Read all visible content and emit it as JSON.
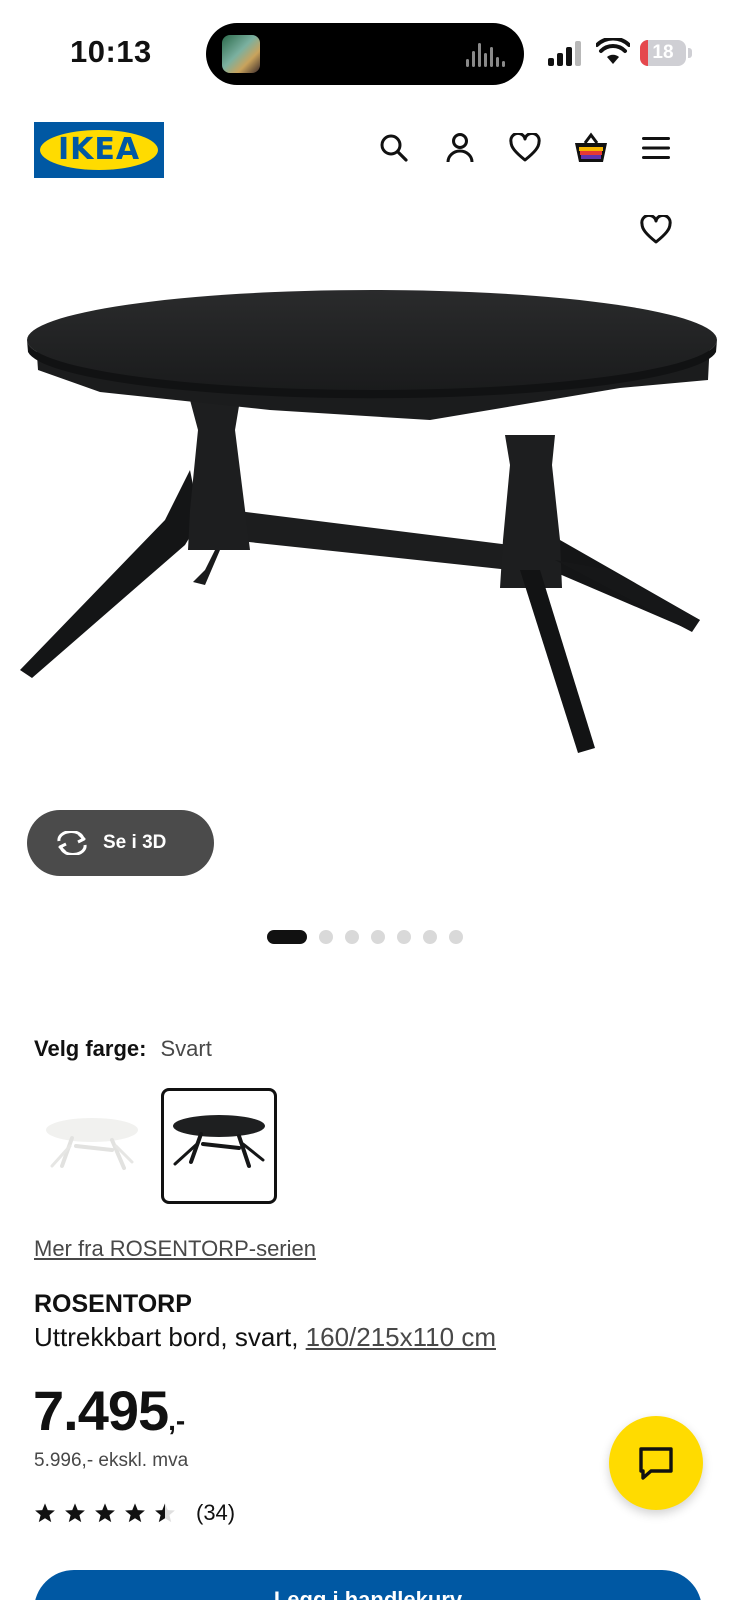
{
  "status_bar": {
    "time": "10:13",
    "battery": "18",
    "battery_level": 0.18,
    "battery_color": "#e5484d"
  },
  "header": {
    "logo_text": "IKEA",
    "icons": [
      "search-icon",
      "account-icon",
      "favorites-icon",
      "cart-icon",
      "menu-icon"
    ]
  },
  "gallery": {
    "view_3d_label": "Se i 3D",
    "slide_count": 7,
    "active_slide": 1
  },
  "color_selection": {
    "label": "Velg farge:",
    "selected": "Svart",
    "options": [
      "white-variant",
      "black-variant"
    ]
  },
  "series_link": "Mer fra ROSENTORP-serien",
  "product": {
    "name": "ROSENTORP",
    "description": "Uttrekkbart bord, svart,",
    "size": "160/215x110 cm"
  },
  "price": {
    "main": "7.495",
    "suffix": ",-",
    "ex_vat": "5.996,- ekskl. mva"
  },
  "rating": {
    "stars": 4.5,
    "count": "(34)"
  },
  "cart_button_label": "Legg i handlekurv",
  "colors": {
    "ikea_blue": "#0058a3",
    "ikea_yellow": "#ffdb00",
    "button_3d": "#4b4b4b"
  }
}
